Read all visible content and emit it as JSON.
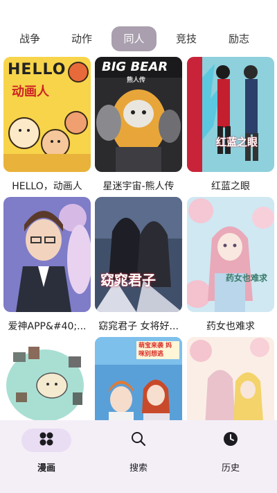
{
  "tabs": [
    {
      "label": "战争"
    },
    {
      "label": "动作"
    },
    {
      "label": "同人"
    },
    {
      "label": "竞技"
    },
    {
      "label": "励志"
    }
  ],
  "active_tab": "同人",
  "comics": [
    {
      "title": "HELLO，动画人",
      "cover_text": "HELLO",
      "cover_sub": "动画人"
    },
    {
      "title": "星迷宇宙-熊人传",
      "cover_text": "BIG BEAR",
      "cover_sub": "熊人传"
    },
    {
      "title": "红蓝之眼",
      "cover_text": "红蓝之眼"
    },
    {
      "title": "爱神APP&#40;..."
    },
    {
      "title": "窈窕君子 女将好...",
      "cover_text": "窈窕君子"
    },
    {
      "title": "药女也难求",
      "cover_text": "药女也难求"
    },
    {
      "title": ""
    },
    {
      "title": "",
      "cover_text": "萌宝来袭 妈咪别想逃"
    },
    {
      "title": ""
    }
  ],
  "bottom_nav": [
    {
      "label": "漫画",
      "icon": "grid-icon"
    },
    {
      "label": "搜索",
      "icon": "search-icon"
    },
    {
      "label": "历史",
      "icon": "clock-icon"
    }
  ],
  "colors": {
    "active_tab_bg": "#a99fae",
    "nav_bg": "#f4eff7",
    "nav_active_pill": "#e9ddf3"
  }
}
